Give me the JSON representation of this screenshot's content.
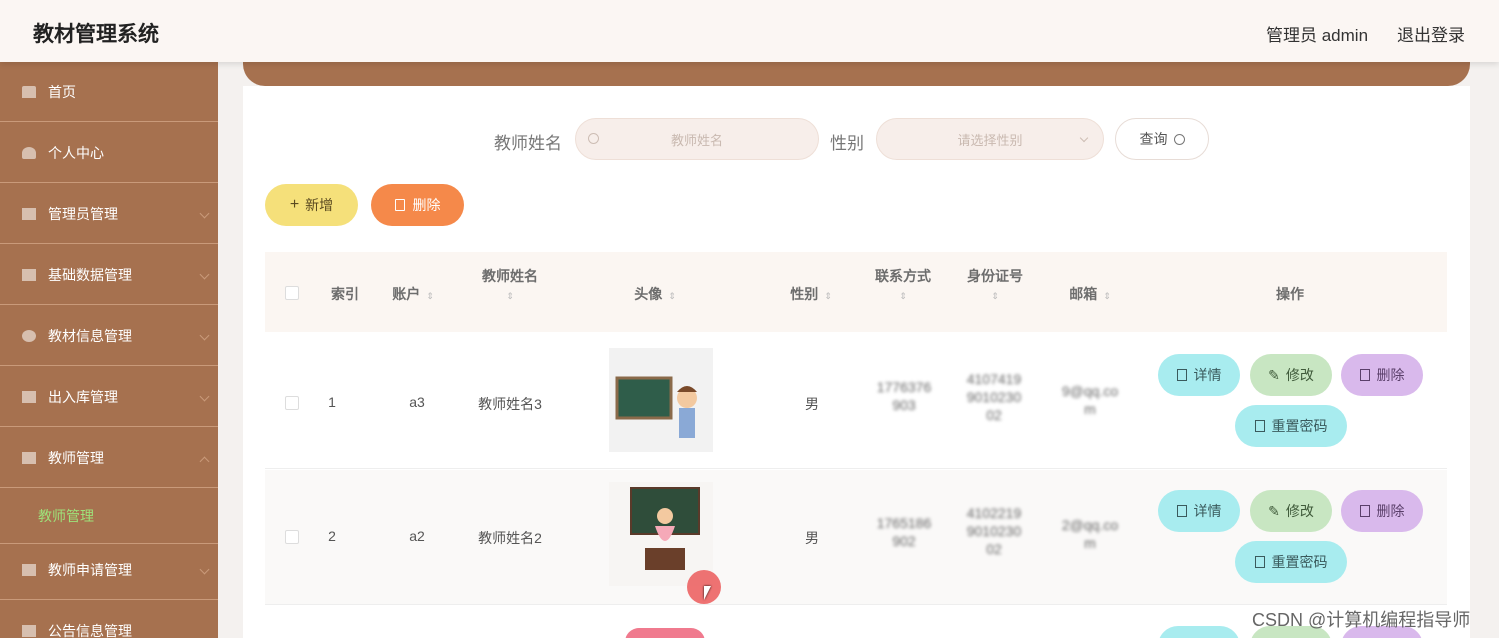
{
  "header": {
    "title": "教材管理系统",
    "admin": "管理员 admin",
    "logout": "退出登录"
  },
  "sidebar": {
    "items": [
      {
        "label": "首页"
      },
      {
        "label": "个人中心"
      },
      {
        "label": "管理员管理"
      },
      {
        "label": "基础数据管理"
      },
      {
        "label": "教材信息管理"
      },
      {
        "label": "出入库管理"
      },
      {
        "label": "教师管理"
      },
      {
        "label": "教师申请管理"
      },
      {
        "label": "公告信息管理"
      }
    ],
    "active_sub": "教师管理"
  },
  "search": {
    "teacher_label": "教师姓名",
    "teacher_placeholder": "教师姓名",
    "gender_label": "性别",
    "gender_placeholder": "请选择性别",
    "query_button": "查询"
  },
  "actions": {
    "add": "新增",
    "delete": "删除"
  },
  "table": {
    "headers": [
      "索引",
      "账户",
      "教师姓名",
      "头像",
      "性别",
      "联系方式",
      "身份证号",
      "邮箱",
      "操作"
    ],
    "rows": [
      {
        "index": "1",
        "account": "a3",
        "name": "教师姓名3",
        "gender": "男"
      },
      {
        "index": "2",
        "account": "a2",
        "name": "教师姓名2",
        "gender": "男"
      }
    ],
    "op_labels": {
      "detail": "详情",
      "edit": "修改",
      "delete": "删除",
      "reset": "重置密码"
    }
  },
  "watermark": "CSDN @计算机编程指导师"
}
